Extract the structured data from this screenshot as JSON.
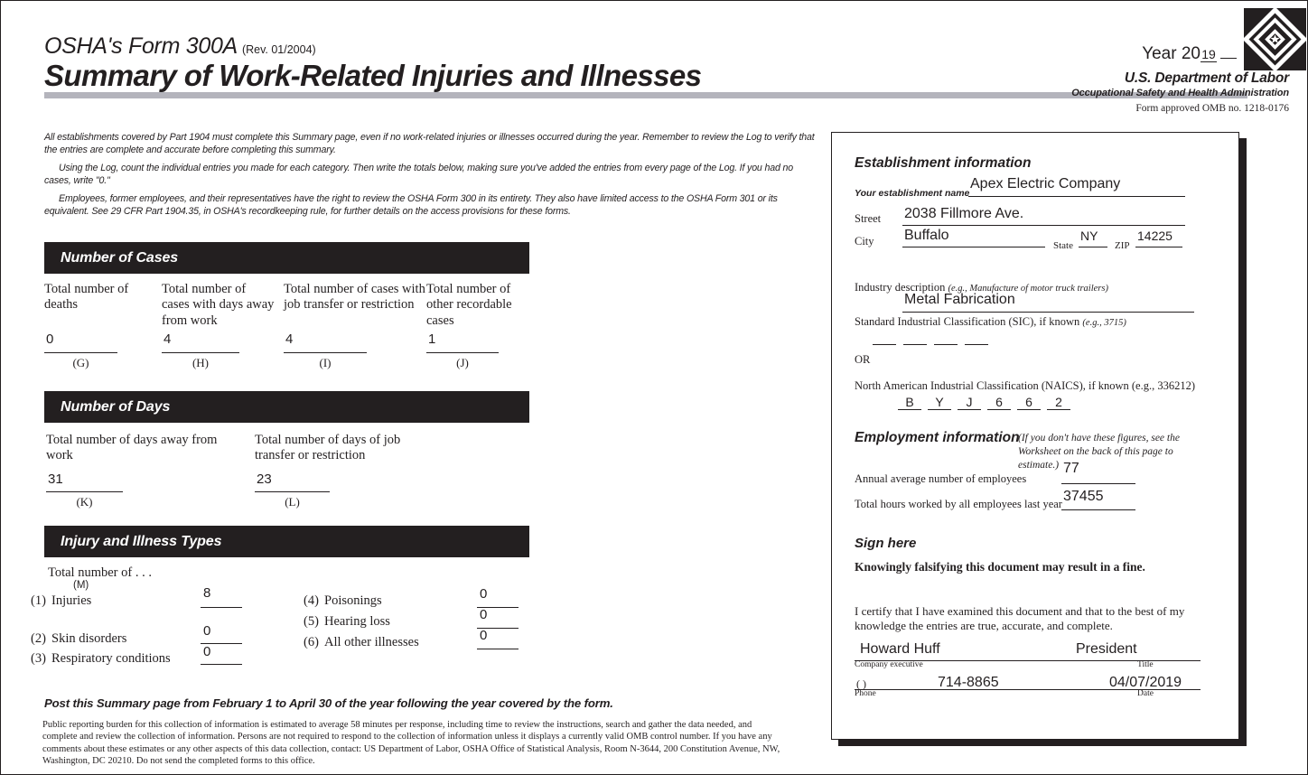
{
  "header": {
    "form_number": "OSHA's Form 300A",
    "revision": "(Rev. 01/2004)",
    "title": "Summary of Work-Related Injuries and Illnesses",
    "year_label": "Year 20",
    "year_value": "19",
    "agency_line1": "U.S. Department of Labor",
    "agency_line2": "Occupational Safety and Health Administration",
    "omb": "Form approved OMB no. 1218-0176",
    "seal_name": "dol-seal-icon"
  },
  "intro": {
    "p1": "All establishments covered by Part 1904 must complete this Summary page, even if no work-related injuries or illnesses occurred during the year. Remember to review the Log to verify that the entries are complete and accurate before completing this summary.",
    "p2": "Using the Log, count the individual entries you made for each category. Then write the totals below, making sure you've added the entries from every page of the Log. If you had no cases, write \"0.\"",
    "p3": "Employees, former employees, and their representatives have the right to review the OSHA Form 300 in its entirety. They also have limited access to the OSHA Form 301 or its equivalent. See 29 CFR Part 1904.35, in OSHA's recordkeeping rule, for further details on the access provisions for these forms."
  },
  "number_of_cases": {
    "section_title": "Number of Cases",
    "columns": [
      {
        "label": "Total number of deaths",
        "value": "0",
        "code": "(G)"
      },
      {
        "label": "Total number of cases with days away from work",
        "value": "4",
        "code": "(H)"
      },
      {
        "label": "Total number of cases with job transfer or restriction",
        "value": "4",
        "code": "(I)"
      },
      {
        "label": "Total number of other recordable cases",
        "value": "1",
        "code": "(J)"
      }
    ]
  },
  "number_of_days": {
    "section_title": "Number of Days",
    "columns": [
      {
        "label": "Total number of days away from work",
        "value": "31",
        "code": "(K)"
      },
      {
        "label": "Total number of days of job transfer or restriction",
        "value": "23",
        "code": "(L)"
      }
    ]
  },
  "injury_illness_types": {
    "section_title": "Injury and Illness Types",
    "total_label": "Total number of . . .",
    "code": "(M)",
    "left": [
      {
        "num": "(1)",
        "label": "Injuries",
        "value": "8"
      },
      {
        "num": "(2)",
        "label": "Skin disorders",
        "value": "0"
      },
      {
        "num": "(3)",
        "label": "Respiratory conditions",
        "value": "0"
      }
    ],
    "right": [
      {
        "num": "(4)",
        "label": "Poisonings",
        "value": "0"
      },
      {
        "num": "(5)",
        "label": "Hearing loss",
        "value": "0"
      },
      {
        "num": "(6)",
        "label": "All other illnesses",
        "value": "0"
      }
    ]
  },
  "footer": {
    "post_line": "Post this Summary page from February 1 to April 30 of the year following the year covered by the form.",
    "burden": "Public reporting burden for this collection of information is estimated to average 58 minutes per response, including time to review the instructions, search and gather the data needed, and complete and review the collection of information. Persons are not required to respond to the collection of information unless it displays a currently valid OMB control number. If you have any comments about these estimates or any other aspects of this data collection, contact: US Department of Labor, OSHA Office of Statistical Analysis, Room N-3644, 200 Constitution Avenue, NW, Washington, DC 20210. Do not send the completed forms to this office."
  },
  "establishment": {
    "heading": "Establishment information",
    "name_label": "Your establishment name",
    "name_value": "Apex Electric Company",
    "street_label": "Street",
    "street_value": "2038 Fillmore Ave.",
    "city_label": "City",
    "city_value": "Buffalo",
    "state_label": "State",
    "state_value": "NY",
    "zip_label": "ZIP",
    "zip_value": "14225",
    "industry_label": "Industry description",
    "industry_hint": "(e.g., Manufacture of motor truck trailers)",
    "industry_value": "Metal Fabrication",
    "sic_label": "Standard Industrial Classification (SIC), if known",
    "sic_hint": "(e.g., 3715)",
    "sic_digits": [
      "",
      "",
      "",
      ""
    ],
    "or_label": "OR",
    "naics_label": "North American Industrial Classification (NAICS), if known (e.g., 336212)",
    "naics_digits": [
      "B",
      "Y",
      "J",
      "6",
      "6",
      "2"
    ]
  },
  "employment": {
    "heading": "Employment information",
    "hint": "(If you don't have these figures, see the Worksheet on the back of this page to estimate.)",
    "avg_employees_label": "Annual average number of employees",
    "avg_employees_value": "77",
    "total_hours_label": "Total hours worked by all employees last year",
    "total_hours_value": "37455"
  },
  "sign": {
    "heading": "Sign here",
    "warning": "Knowingly falsifying this document may result in a fine.",
    "certify": "I certify that I have examined this document and that to the best of my knowledge the entries are true, accurate, and complete.",
    "executive_value": "Howard Huff",
    "executive_label": "Company executive",
    "title_value": "President",
    "title_label": "Title",
    "phone_value": "714-8865",
    "phone_prefix": "(         )",
    "phone_label": "Phone",
    "date_value": "04/07/2019",
    "date_label": "Date"
  },
  "colors": {
    "ink": "#231f20",
    "rule_gray": "#b4b4bc"
  }
}
